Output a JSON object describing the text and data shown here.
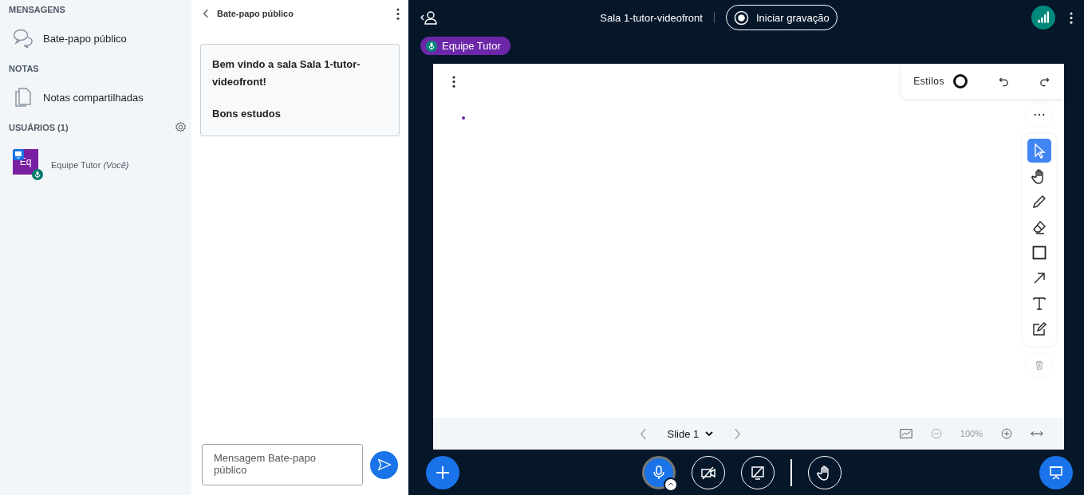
{
  "sidebar": {
    "messages_heading": "MENSAGENS",
    "public_chat": {
      "label": "Bate-papo público"
    },
    "notes_heading": "NOTAS",
    "shared_notes": {
      "label": "Notas compartilhadas"
    },
    "users_heading": "USUÁRIOS (1)",
    "users": [
      {
        "initials": "Eq",
        "name": "Equipe Tutor",
        "suffix": "(Você)",
        "color": "#7b1fa2",
        "presenter": true,
        "mic_on": true
      }
    ]
  },
  "chat": {
    "title": "Bate-papo público",
    "welcome": "Bem vindo a sala **Sala 1-tutor-videofront!**",
    "welcome_2": "Bons estudos",
    "placeholder": "Mensagem Bate-papo público"
  },
  "topbar": {
    "title": "Sala 1-tutor-videofront",
    "record_label": "Iniciar gravação"
  },
  "talking": {
    "name": "Equipe Tutor"
  },
  "whiteboard": {
    "styles_label": "Estilos",
    "tools": [
      {
        "kind": "select",
        "selected": true
      },
      {
        "kind": "pan",
        "selected": false
      },
      {
        "kind": "pencil",
        "selected": false
      },
      {
        "kind": "eraser",
        "selected": false
      },
      {
        "kind": "rectangle",
        "selected": false
      },
      {
        "kind": "arrow",
        "selected": false
      },
      {
        "kind": "text",
        "selected": false
      },
      {
        "kind": "note",
        "selected": false
      }
    ],
    "slide_label": "Slide 1",
    "zoom": "100%"
  },
  "actions": {
    "mic_on": true,
    "camera_on": false,
    "screenshare_on": false
  }
}
